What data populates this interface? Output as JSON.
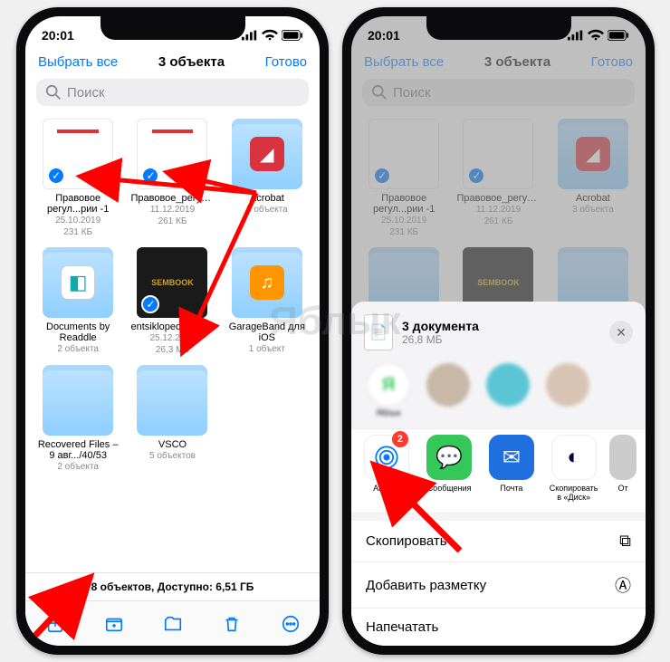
{
  "statusbar": {
    "time": "20:01"
  },
  "left": {
    "nav": {
      "select_all": "Выбрать все",
      "title": "3 объекта",
      "done": "Готово"
    },
    "search_placeholder": "Поиск",
    "files": [
      {
        "name": "Правовое регул...рии -1",
        "date": "25.10.2019",
        "size": "231 КБ",
        "selected": true,
        "kind": "doc"
      },
      {
        "name": "Правовое_регулиро...еской",
        "date": "11.12.2019",
        "size": "261 КБ",
        "selected": true,
        "kind": "doc"
      },
      {
        "name": "Acrobat",
        "meta": "3 объекта",
        "kind": "folder",
        "icon_bg": "#d9333f",
        "icon_glyph": "◢"
      },
      {
        "name": "Documents by Readdle",
        "meta": "2 объекта",
        "kind": "folder",
        "icon_bg": "#ffffff",
        "icon_glyph": "◧"
      },
      {
        "name": "entsiklopediya_poisko...heniya",
        "date": "25.12.2019",
        "size": "26,3 МБ",
        "selected": true,
        "kind": "book"
      },
      {
        "name": "GarageBand для iOS",
        "meta": "1 объект",
        "kind": "folder",
        "icon_bg": "#ff9500",
        "icon_glyph": "🎸"
      },
      {
        "name": "Recovered Files – 9 авг.../40/53",
        "meta": "2 объекта",
        "kind": "folder"
      },
      {
        "name": "VSCO",
        "meta": "5 объектов",
        "kind": "folder"
      }
    ],
    "footer": "8 объектов, Доступно: 6,51 ГБ"
  },
  "right": {
    "nav": {
      "select_all": "Выбрать все",
      "title": "3 объекта",
      "done": "Готово"
    },
    "search_placeholder": "Поиск",
    "sheet": {
      "title": "3 документа",
      "subtitle": "26,8 МБ",
      "contacts": [
        {
          "label": "Яблык",
          "avatar_text": "Я",
          "avatar_bg": "#ffffff",
          "avatar_fg": "#34c759"
        }
      ],
      "apps": [
        {
          "label": "AirDrop",
          "bg": "#ffffff",
          "glyph_color": "#007aff",
          "badge": "2"
        },
        {
          "label": "Сообщения",
          "bg": "#34c759"
        },
        {
          "label": "Почта",
          "bg": "#1f6fde"
        },
        {
          "label": "Скопировать в «Диск»",
          "bg": "#ffffff"
        },
        {
          "label": "От"
        }
      ],
      "actions": {
        "copy": "Скопировать",
        "markup": "Добавить разметку",
        "print": "Напечатать"
      }
    }
  },
  "watermark": "Яблык"
}
